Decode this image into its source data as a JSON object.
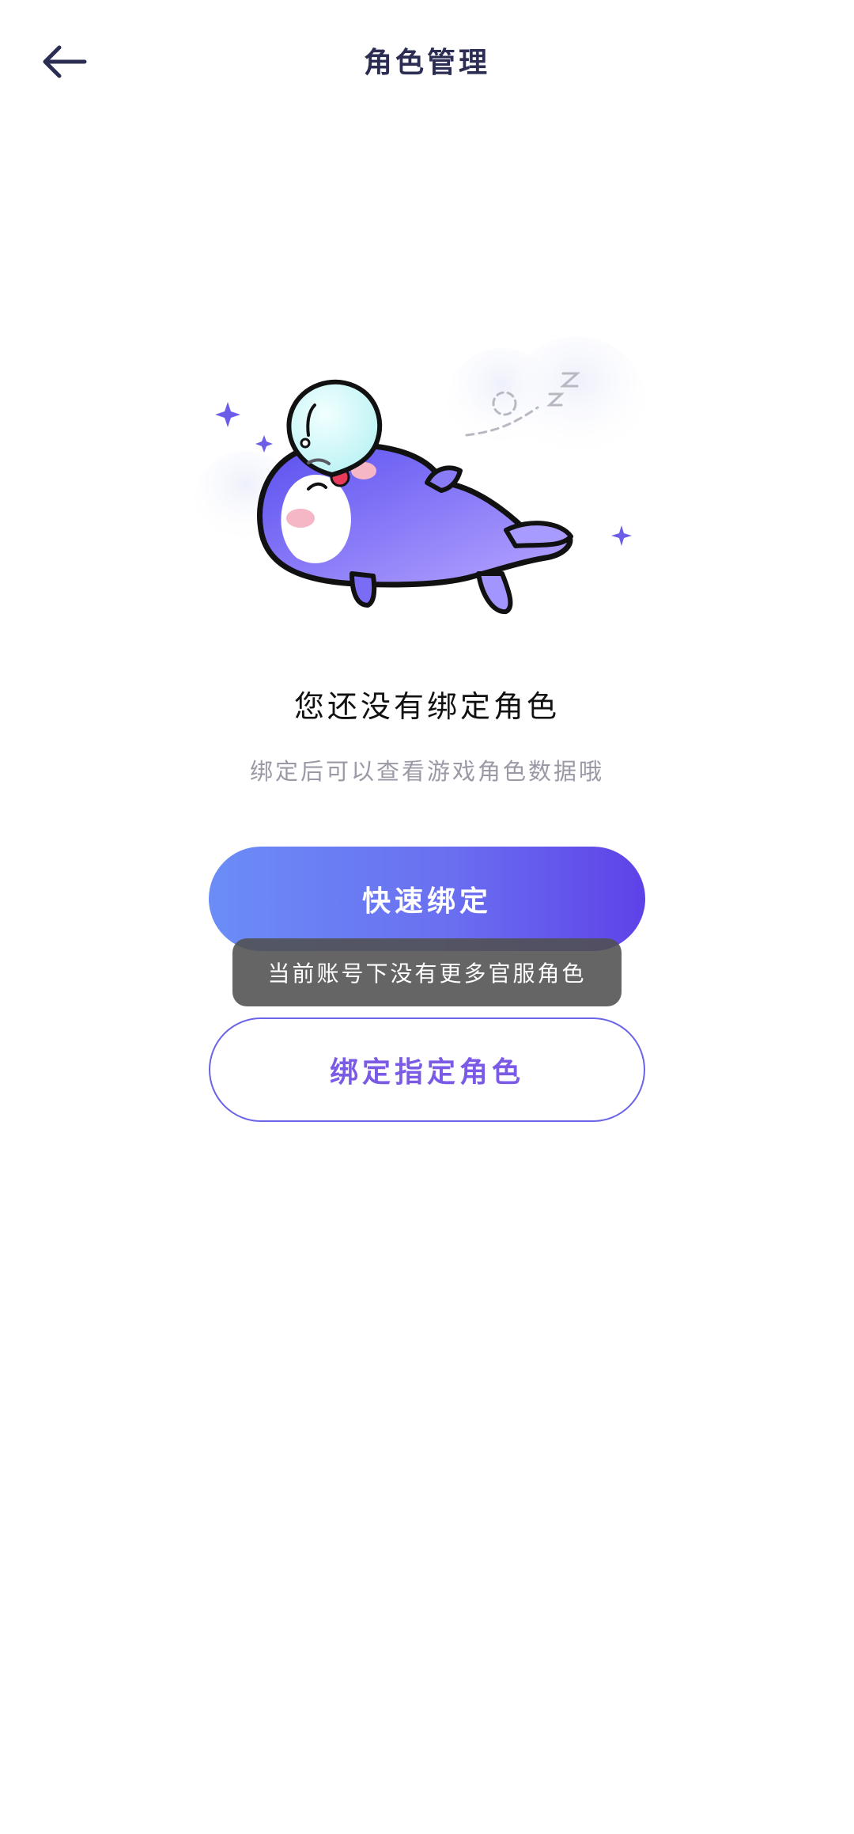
{
  "header": {
    "title": "角色管理",
    "back_icon": "arrow-left-icon"
  },
  "empty_state": {
    "illustration": "sleeping-whale-illustration",
    "title": "您还没有绑定角色",
    "subtitle": "绑定后可以查看游戏角色数据哦"
  },
  "actions": {
    "quick_bind_label": "快速绑定",
    "bind_specific_label": "绑定指定角色"
  },
  "toast": {
    "message": "当前账号下没有更多官服角色"
  },
  "colors": {
    "title": "#2b2d52",
    "accent_start": "#6b8df7",
    "accent_end": "#5e42e8",
    "secondary_text": "#7b5be6",
    "muted": "#9a9aa6"
  }
}
